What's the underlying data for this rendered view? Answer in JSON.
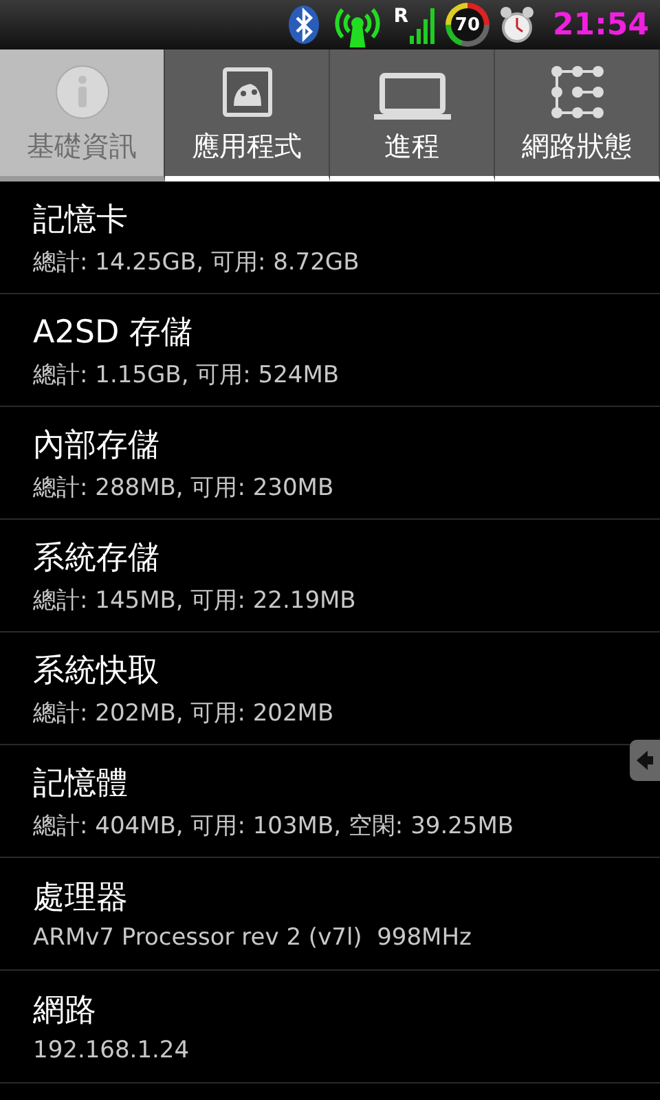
{
  "status_bar": {
    "battery": "70",
    "time": "21:54",
    "signal_roaming": "R"
  },
  "tabs": [
    {
      "label": "基礎資訊",
      "selected": true,
      "kind": "info"
    },
    {
      "label": "應用程式",
      "selected": false,
      "kind": "apps"
    },
    {
      "label": "進程",
      "selected": false,
      "kind": "process"
    },
    {
      "label": "網路狀態",
      "selected": false,
      "kind": "network"
    }
  ],
  "items": [
    {
      "title": "記憶卡",
      "detail": "總計: 14.25GB, 可用: 8.72GB"
    },
    {
      "title": "A2SD 存儲",
      "detail": "總計: 1.15GB, 可用: 524MB"
    },
    {
      "title": "內部存儲",
      "detail": "總計: 288MB, 可用: 230MB"
    },
    {
      "title": "系統存儲",
      "detail": "總計: 145MB, 可用: 22.19MB"
    },
    {
      "title": "系統快取",
      "detail": "總計: 202MB, 可用: 202MB"
    },
    {
      "title": "記憶體",
      "detail": "總計: 404MB, 可用: 103MB, 空閑: 39.25MB"
    },
    {
      "title": "處理器",
      "detail": "ARMv7 Processor rev 2 (v7l)  998MHz"
    },
    {
      "title": "網路",
      "detail": "192.168.1.24"
    }
  ]
}
